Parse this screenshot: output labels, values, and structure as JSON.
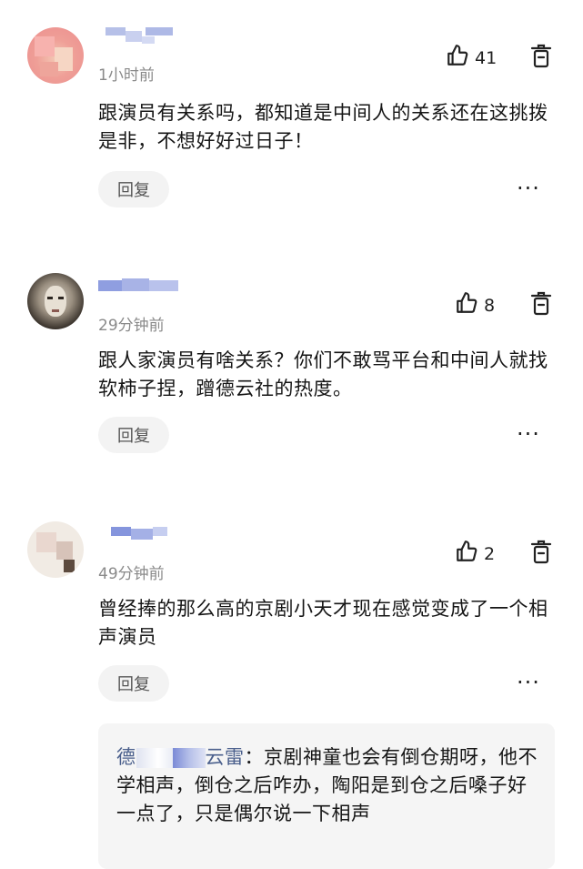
{
  "comments": [
    {
      "time": "1小时前",
      "likes": "41",
      "text": "跟演员有关系吗，都知道是中间人的关系还在这挑拨是非，不想好好过日子！",
      "reply_label": "回复",
      "more_label": "···"
    },
    {
      "time": "29分钟前",
      "likes": "8",
      "text": "跟人家演员有啥关系？你们不敢骂平台和中间人就找软柿子捏，蹭德云社的热度。",
      "reply_label": "回复",
      "more_label": "···"
    },
    {
      "time": "49分钟前",
      "likes": "2",
      "text": "曾经捧的那么高的京剧小天才现在感觉变成了一个相声演员",
      "reply_label": "回复",
      "more_label": "···"
    }
  ],
  "sub_reply": {
    "name_start": "德",
    "name_end": "云雷",
    "separator": "：",
    "text": "京剧神童也会有倒仓期呀，他不学相声，倒仓之后咋办，陶阳是到仓之后嗓子好一点了，只是偶尔说一下相声"
  },
  "icons": {
    "like": "thumbs-up-icon",
    "delete": "trash-icon"
  },
  "colors": {
    "muted_text": "#8a8a8a",
    "reply_bg": "#f3f3f3",
    "sub_reply_bg": "#f5f5f5",
    "sub_reply_name": "#4a5f8c"
  }
}
